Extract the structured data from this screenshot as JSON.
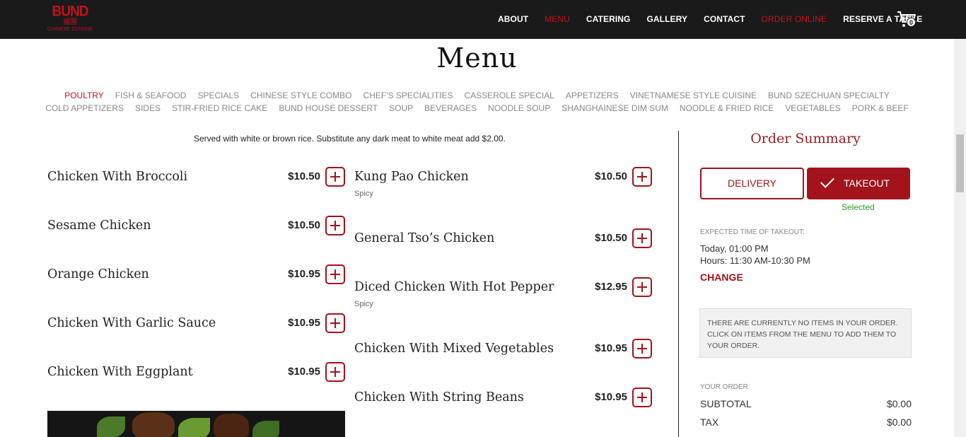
{
  "brand": {
    "logo_word": "BUND",
    "logo_chars": "福園",
    "logo_sub": "CHINESE CUISINE"
  },
  "nav": [
    {
      "label": "ABOUT",
      "active": false
    },
    {
      "label": "MENU",
      "active": true
    },
    {
      "label": "CATERING",
      "active": false
    },
    {
      "label": "GALLERY",
      "active": false
    },
    {
      "label": "CONTACT",
      "active": false
    },
    {
      "label": "ORDER ONLINE",
      "active": true
    },
    {
      "label": "RESERVE A TABLE",
      "active": false
    }
  ],
  "cart": {
    "count": "0"
  },
  "page_title": "Menu",
  "categories_row1": [
    "POULTRY",
    "FISH & SEAFOOD",
    "SPECIALS",
    "CHINESE STYLE COMBO",
    "CHEF'S SPECIALITIES",
    "CASSEROLE SPECIAL",
    "APPETIZERS",
    "VINETNAMESE STYLE CUISINE",
    "BUND SZECHUAN SPECIALTY"
  ],
  "categories_row2": [
    "COLD APPETIZERS",
    "SIDES",
    "STIR-FRIED RICE CAKE",
    "BUND HOUSE DESSERT",
    "SOUP",
    "BEVERAGES",
    "NOODLE SOUP",
    "SHANGHAINESE DIM SUM",
    "NOODLE & FRIED RICE",
    "VEGETABLES",
    "PORK & BEEF"
  ],
  "active_category": "POULTRY",
  "section_note": "Served with white or brown rice. Substitute any dark meat to white meat add $2.00.",
  "left_items": [
    {
      "name": "Chicken With Broccoli",
      "price": "$10.50",
      "tag": ""
    },
    {
      "name": "Sesame Chicken",
      "price": "$10.50",
      "tag": ""
    },
    {
      "name": "Orange Chicken",
      "price": "$10.95",
      "tag": ""
    },
    {
      "name": "Chicken With Garlic Sauce",
      "price": "$10.95",
      "tag": ""
    },
    {
      "name": "Chicken With Eggplant",
      "price": "$10.95",
      "tag": ""
    }
  ],
  "right_items": [
    {
      "name": "Kung Pao Chicken",
      "price": "$10.50",
      "tag": "Spicy"
    },
    {
      "name": "General Tso’s Chicken",
      "price": "$10.50",
      "tag": ""
    },
    {
      "name": "Diced Chicken With Hot Pepper",
      "price": "$12.95",
      "tag": "Spicy"
    },
    {
      "name": "Chicken With Mixed Vegetables",
      "price": "$10.95",
      "tag": ""
    },
    {
      "name": "Chicken With String Beans",
      "price": "$10.95",
      "tag": ""
    }
  ],
  "order_summary": {
    "title": "Order Summary",
    "delivery_label": "DELIVERY",
    "takeout_label": "TAKEOUT",
    "selected_label": "Selected",
    "expected_label": "EXPECTED TIME OF TAKEOUT:",
    "expected_time": "Today, 01:00 PM",
    "hours": "Hours: 11:30 AM-10:30 PM",
    "change_label": "CHANGE",
    "empty_message": "THERE ARE CURRENTLY NO ITEMS IN YOUR ORDER. CLICK ON ITEMS FROM THE MENU TO ADD THEM TO YOUR ORDER.",
    "your_order_label": "YOUR ORDER",
    "subtotal_label": "SUBTOTAL",
    "subtotal_value": "$0.00",
    "tax_label": "TAX",
    "tax_value": "$0.00"
  },
  "colors": {
    "brand_red": "#a3131b",
    "nav_bg": "#1a1a1a",
    "selected_green": "#2aa22a"
  }
}
